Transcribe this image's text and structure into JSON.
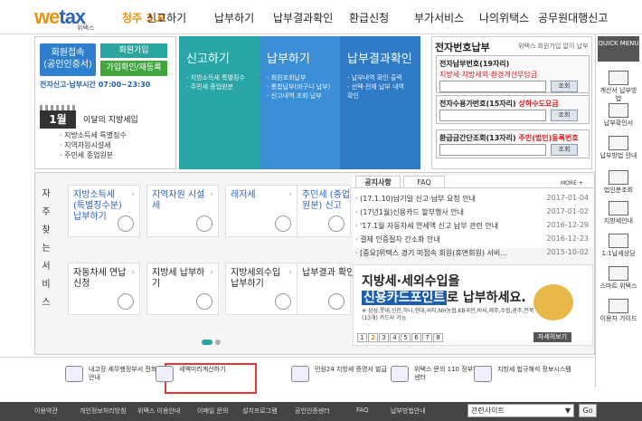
{
  "header": {
    "logo_main": "wetax",
    "logo_sub": "위택스",
    "badge": "청주 3.0",
    "menu": [
      "신고하기",
      "납부하기",
      "납부결과확인",
      "환급신청",
      "부가서비스",
      "나의위택스",
      "공무원대행신고"
    ]
  },
  "login": {
    "login_label": "회원접속",
    "login_sub": "(공인인증서)",
    "join_label": "회원가입",
    "find_label": "가입확인/재등록",
    "service_time": "전자신고·납부시간 07:00~23:30"
  },
  "month": {
    "num": "1월",
    "title": "이달의 지방세입",
    "items": [
      "· 지방소득세 특별징수",
      "· 지역자원시설세",
      "· 주민세 종업원분"
    ]
  },
  "tiles": [
    {
      "title": "신고하기",
      "items": [
        "- 지방소득세 특별징수",
        "- 주민세 종업원분"
      ],
      "color": "#2aa6a6"
    },
    {
      "title": "납부하기",
      "items": [
        "- 회원조회납부",
        "- 통합납부(바구니 납부)",
        "- 신고내역 조회·납부"
      ],
      "color": "#3a8fd6"
    },
    {
      "title": "납부결과확인",
      "items": [
        "- 납부내역 확인·출력",
        "- 선택·전체 납부 내역",
        "  확인"
      ],
      "color": "#2f7bc5"
    }
  ],
  "epay": {
    "title": "전자번호납부",
    "sub": "위택스 회원가입 없이 납부",
    "row1_label": "전자납부번호(19자리)",
    "row1_sub": "지방세·지방세외·환경개선부담금",
    "row2_label": "전자수용가번호(15자리)",
    "row2_sub": "상하수도요금",
    "row3_label": "환급금간단조회(13자리)",
    "row3_sub": "주민(법인)등록번호",
    "btn": "조회"
  },
  "quick": {
    "head": "QUICK MENU",
    "items": [
      "계산서 납부방법",
      "납부확인서",
      "납부방법 안내",
      "법인분조회",
      "지방세안내",
      "1:1납세상담",
      "스마트 위택스",
      "이용자 가이드"
    ]
  },
  "self_service": {
    "side": [
      "자",
      "주",
      "찾",
      "는",
      "서",
      "비",
      "스"
    ],
    "cards": [
      {
        "label": "지방소득세 (특별징수분) 납부하기",
        "blue": true
      },
      {
        "label": "지역자원 시설세",
        "blue": true
      },
      {
        "label": "레저세",
        "blue": true
      },
      {
        "label": "주민세 (종업원분) 신고",
        "blue": true
      },
      {
        "label": "자동차세 연납신청",
        "blue": false
      },
      {
        "label": "지방세 납부하기",
        "blue": false
      },
      {
        "label": "지방세외수입 납부하기",
        "blue": false
      },
      {
        "label": "납부결과 확인",
        "blue": false
      }
    ]
  },
  "notice": {
    "tab1": "공지사항",
    "tab2": "FAQ",
    "more": "MORE +",
    "rows": [
      {
        "t": "· (17.1.10)납기일 신고·납부 요청 안내",
        "d": "2017-01-04"
      },
      {
        "t": "· (17년1월)신용카드 할부행사 안내",
        "d": "2017-01-02"
      },
      {
        "t": "· '17.1월 자동차세 연세액 신고 납부 관련 안내",
        "d": "2016-12-29"
      },
      {
        "t": "· 결제 인증절차 간소화 안내",
        "d": "2016-12-23"
      },
      {
        "t": "· [중요]위택스 경기 미접속 회원(휴면회원) 서비…",
        "d": "2015-10-02"
      }
    ]
  },
  "banner": {
    "line1": "지방세·세외수입을",
    "hl": "신용카드포인트",
    "line2b": "로 납부하세요.",
    "line3": "※ 삼성,롯데,신한,하나,현대,씨티,NH농협,KB국민,비씨,제주,수협,광주,전북(13개) 카드사 가능",
    "pages": [
      "1",
      "2",
      "3",
      "4",
      "5",
      "6",
      "7",
      "8"
    ],
    "detail": "자세히보기"
  },
  "bottom": [
    "내고장 세무행정부서 전화번호 안내",
    "세액미리계산하기",
    "민원24 지방세 증명서 발급",
    "위택스 문의 110 정부민원 콜센터",
    "지방세 법규해석 정보시스템"
  ],
  "footer": {
    "links": [
      "이용약관",
      "개인정보처리방침",
      "위택스 이용안내",
      "이메일 문의",
      "설치프로그램",
      "공인인증센터",
      "FAQ",
      "납부방법안내"
    ],
    "select": "관련사이트",
    "go": "Go"
  }
}
